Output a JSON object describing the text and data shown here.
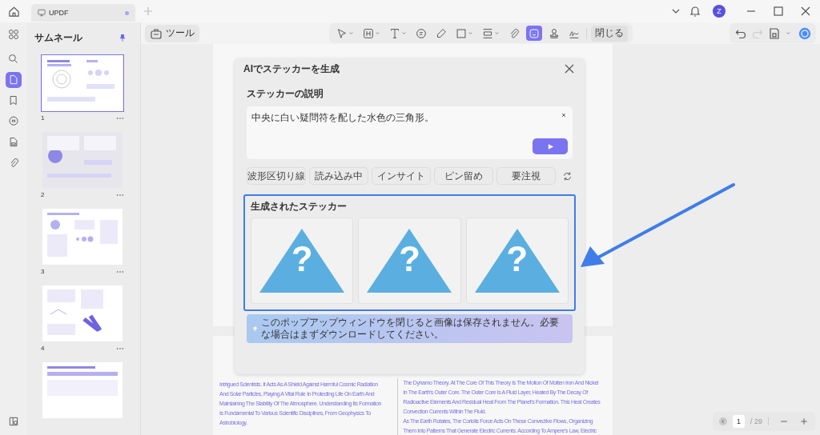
{
  "tabs": [
    {
      "label": "UPDF",
      "selected": true,
      "unsaved": true
    }
  ],
  "account": {
    "avatar": "Z"
  },
  "rail": [
    {
      "kind": "search",
      "selected": false
    },
    {
      "kind": "pages",
      "selected": true
    },
    {
      "kind": "bookmark",
      "selected": false
    },
    {
      "kind": "comment",
      "selected": false
    },
    {
      "kind": "form",
      "selected": false
    },
    {
      "kind": "attachment",
      "selected": false
    }
  ],
  "thumbnails": {
    "title": "サムネール",
    "pinned": true,
    "pages": [
      {
        "number": "1",
        "selected": true,
        "kind": "magnetic"
      },
      {
        "number": "2",
        "selected": false,
        "kind": "earth"
      },
      {
        "number": "3",
        "selected": false,
        "kind": "evidence"
      },
      {
        "number": "4",
        "selected": false,
        "kind": "satellite"
      },
      {
        "selected": false,
        "kind": "table"
      }
    ]
  },
  "tools_button": "ツール",
  "toolbar": {
    "tools": [
      {
        "kind": "select",
        "dropdown": true,
        "selected": false
      },
      {
        "kind": "textbox",
        "dropdown": true,
        "selected": false
      },
      {
        "kind": "text",
        "dropdown": true,
        "selected": false
      },
      {
        "kind": "comment",
        "dropdown": false,
        "selected": false
      },
      {
        "kind": "pencil",
        "dropdown": false,
        "selected": false
      },
      {
        "kind": "shape",
        "dropdown": true,
        "selected": false
      },
      {
        "kind": "measure",
        "dropdown": true,
        "selected": false
      },
      {
        "kind": "attach",
        "dropdown": false,
        "selected": false
      },
      {
        "kind": "sticker",
        "dropdown": false,
        "selected": true
      },
      {
        "kind": "stamp",
        "dropdown": false,
        "selected": false
      },
      {
        "kind": "signature",
        "dropdown": false,
        "selected": false
      }
    ],
    "close": "閉じる"
  },
  "history": {
    "undo_disabled": false,
    "redo_disabled": true
  },
  "dialog": {
    "title": "AIでステッカーを生成",
    "description_label": "ステッカーの説明",
    "description": "中央に白い疑問符を配した水色の三角形。",
    "suggestions": [
      "波形区切り線",
      "読み込み中",
      "インサイト",
      "ピン留め",
      "要注視"
    ],
    "generated_label": "生成されたステッカー",
    "stickers": [
      {
        "symbol": "?"
      },
      {
        "symbol": "?"
      },
      {
        "symbol": "?"
      }
    ],
    "notice": "このポップアップウィンドウを閉じると画像は保存されません。必要な場合はまずダウンロードしてください。"
  },
  "document": {
    "left_column": [
      "Intrigued Scientists. It Acts As A Shield Against Harmful Cosmic Radiation",
      "And Solar Particles, Playing A Vital Role In Protecting Life On Earth And",
      "Maintaining The Stability Of The Atmosphere. Understanding Its Formation",
      "Is Fundamental To Various Scientific Disciplines, From Geophysics To",
      "Astrobiology."
    ],
    "right_column": [
      "The Dynamo Theory. At The Core Of This Theory Is The Motion Of Molten Iron And Nickel",
      "In The Earth's Outer Core. The Outer Core Is A Fluid Layer, Heated By The Decay Of",
      "Radioactive Elements And Residual Heat From The Planet's Formation. This Heat Creates",
      "Convection Currents Within The Fluid.",
      "As The Earth Rotates, The Coriolis Force Acts On These Convective Flows, Organizing",
      "Them Into Patterns That Generate Electric Currents. According To Ampere's Law, Electric"
    ]
  },
  "pager": {
    "page": "1",
    "total": "/ 29"
  }
}
